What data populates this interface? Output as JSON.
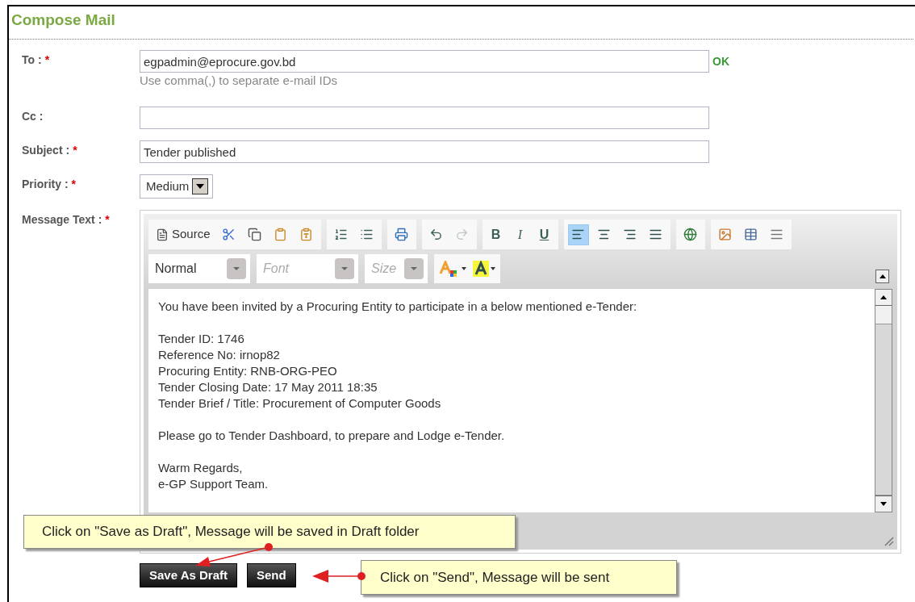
{
  "title": "Compose Mail",
  "fields": [
    {
      "kind": "text",
      "label": "To :",
      "marker": "*",
      "value": "egpadmin@eprocure.gov.bd",
      "hint": "Use comma(,) to separate e-mail IDs",
      "status": "OK"
    },
    {
      "kind": "text",
      "label": "Cc :"
    },
    {
      "kind": "text",
      "label": "Subject :",
      "marker": "*",
      "value": "Tender published"
    },
    {
      "kind": "select",
      "label": "Priority :",
      "marker": "*",
      "value": "Medium"
    }
  ],
  "editor": {
    "label": "Message Text :",
    "marker": "*",
    "toolbar": [
      [
        {
          "kind": "source",
          "label": "Source"
        },
        {
          "kind": "cut"
        },
        {
          "kind": "copy"
        },
        {
          "kind": "paste"
        },
        {
          "kind": "paste-word"
        }
      ],
      [
        {
          "kind": "ordered-list"
        },
        {
          "kind": "bullet-list"
        }
      ],
      [
        {
          "kind": "print"
        }
      ],
      [
        {
          "kind": "undo",
          "disabled": false
        },
        {
          "kind": "redo",
          "disabled": true
        }
      ],
      [
        {
          "kind": "bold",
          "label": "B"
        },
        {
          "kind": "italic",
          "label": "I"
        },
        {
          "kind": "underline",
          "label": "U"
        }
      ],
      [
        {
          "kind": "align-left",
          "selected": true
        },
        {
          "kind": "align-center",
          "selected": false
        },
        {
          "kind": "align-right",
          "selected": false
        },
        {
          "kind": "align-justify",
          "selected": false
        }
      ],
      [
        {
          "kind": "link"
        }
      ],
      [
        {
          "kind": "image"
        },
        {
          "kind": "table"
        },
        {
          "kind": "rule"
        }
      ]
    ],
    "dropdowns": [
      {
        "label": "Normal",
        "placeholder": false
      },
      {
        "label": "Font",
        "placeholder": true
      },
      {
        "label": "Size",
        "placeholder": true
      }
    ],
    "body": [
      [
        "You have been invited by a Procuring Entity to participate in a below mentioned e-Tender:"
      ],
      [
        "Tender ID: 1746",
        "Reference No: irnop82",
        "Procuring Entity: RNB-ORG-PEO",
        "Tender Closing Date: 17 May 2011 18:35",
        "Tender Brief / Title: Procurement of Computer Goods"
      ],
      [
        "Please go to Tender Dashboard, to prepare and Lodge e-Tender."
      ],
      [
        "Warm Regards,",
        "e-GP Support Team."
      ]
    ]
  },
  "buttons": [
    "Save As Draft",
    "Send"
  ],
  "callouts": [
    "Click on \"Save as Draft\", Message will be saved in Draft folder",
    "Click on \"Send\", Message will be sent"
  ]
}
